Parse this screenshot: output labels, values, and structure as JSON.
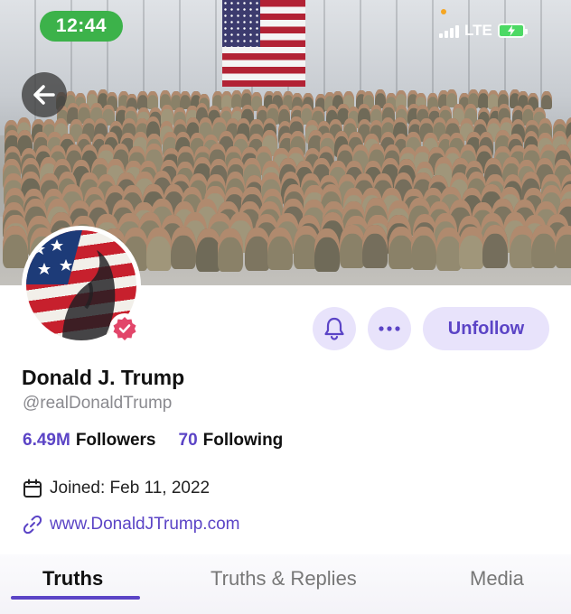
{
  "status_bar": {
    "time": "12:44",
    "network": "LTE",
    "icons": [
      "signal-bars-icon",
      "battery-charging-icon"
    ]
  },
  "header": {
    "back_icon": "back-arrow-icon"
  },
  "profile": {
    "name": "Donald J. Trump",
    "handle": "@realDonaldTrump",
    "followers_count": "6.49M",
    "followers_label": "Followers",
    "following_count": "70",
    "following_label": "Following",
    "joined": "Joined: Feb 11, 2022",
    "website": "www.DonaldJTrump.com",
    "verified": true
  },
  "actions": {
    "notify_icon": "bell-icon",
    "more_icon": "more-dots-icon",
    "unfollow_label": "Unfollow"
  },
  "tabs": [
    {
      "label": "Truths",
      "active": true
    },
    {
      "label": "Truths & Replies",
      "active": false
    },
    {
      "label": "Media",
      "active": false
    }
  ],
  "colors": {
    "accent": "#5b44c6",
    "accent_soft": "#e8e3fb",
    "status_pill": "#3cb24a",
    "verified_badge": "#e2466a"
  }
}
